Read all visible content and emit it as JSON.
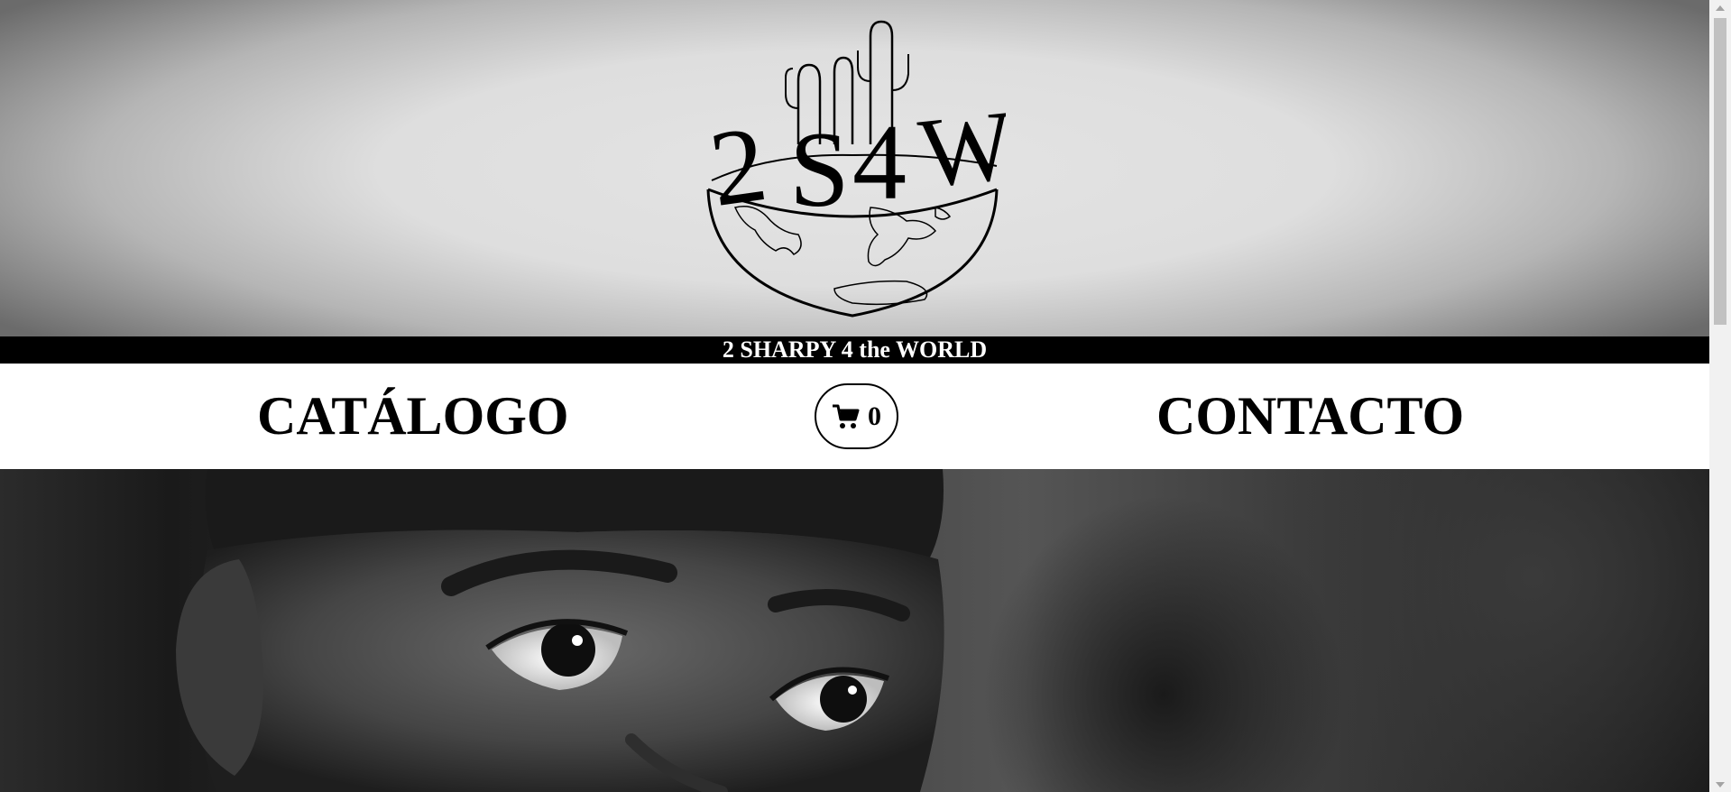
{
  "header": {
    "logo_text": "2S4W",
    "tagline": "2 SHARPY 4 the WORLD"
  },
  "nav": {
    "catalogo_label": "CATÁLOGO",
    "contacto_label": "CONTACTO",
    "cart": {
      "icon": "cart-icon",
      "count": "0"
    }
  },
  "hero": {
    "image": "black-and-white portrait of a child's eyes"
  },
  "colors": {
    "tagline_bar_bg": "#000000",
    "tagline_text": "#ffffff",
    "nav_bg": "#ffffff",
    "text": "#000000"
  }
}
